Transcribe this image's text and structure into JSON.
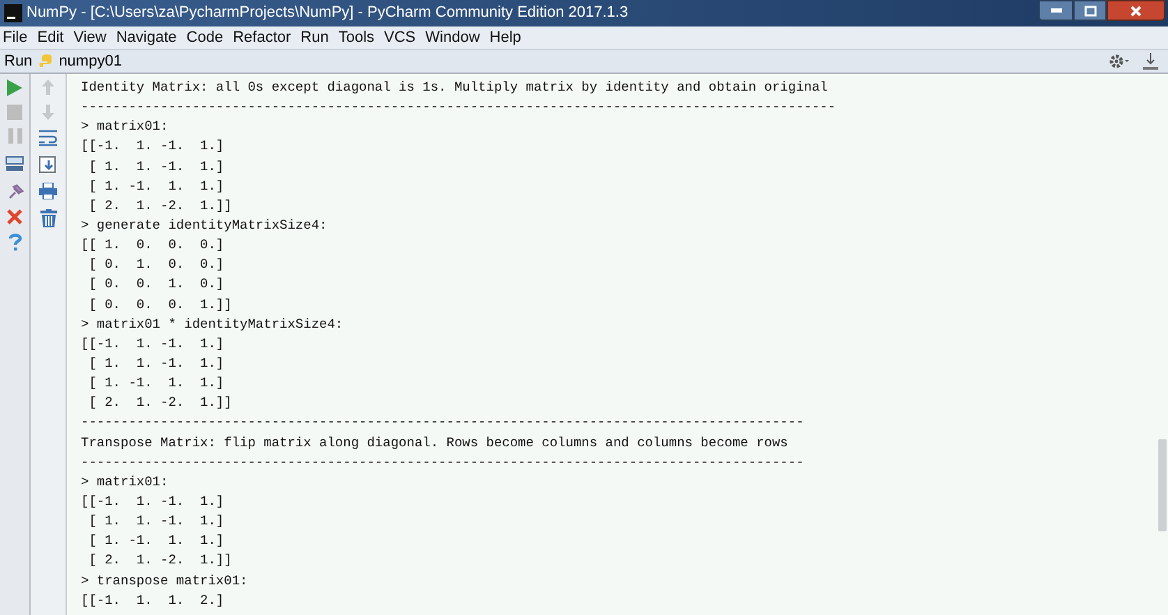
{
  "window": {
    "title": "NumPy - [C:\\Users\\za\\PycharmProjects\\NumPy] - PyCharm Community Edition 2017.1.3"
  },
  "menu": [
    "File",
    "Edit",
    "View",
    "Navigate",
    "Code",
    "Refactor",
    "Run",
    "Tools",
    "VCS",
    "Window",
    "Help"
  ],
  "run_bar": {
    "label": "Run",
    "config": "numpy01"
  },
  "console": {
    "lines": [
      "Identity Matrix: all 0s except diagonal is 1s. Multiply matrix by identity and obtain original",
      "-----------------------------------------------------------------------------------------------",
      "> matrix01:",
      "[[-1.  1. -1.  1.]",
      " [ 1.  1. -1.  1.]",
      " [ 1. -1.  1.  1.]",
      " [ 2.  1. -2.  1.]]",
      "> generate identityMatrixSize4:",
      "[[ 1.  0.  0.  0.]",
      " [ 0.  1.  0.  0.]",
      " [ 0.  0.  1.  0.]",
      " [ 0.  0.  0.  1.]]",
      "> matrix01 * identityMatrixSize4:",
      "[[-1.  1. -1.  1.]",
      " [ 1.  1. -1.  1.]",
      " [ 1. -1.  1.  1.]",
      " [ 2.  1. -2.  1.]]",
      "-------------------------------------------------------------------------------------------",
      "Transpose Matrix: flip matrix along diagonal. Rows become columns and columns become rows",
      "-------------------------------------------------------------------------------------------",
      "> matrix01:",
      "[[-1.  1. -1.  1.]",
      " [ 1.  1. -1.  1.]",
      " [ 1. -1.  1.  1.]",
      " [ 2.  1. -2.  1.]]",
      "> transpose matrix01:",
      "[[-1.  1.  1.  2.]"
    ]
  }
}
